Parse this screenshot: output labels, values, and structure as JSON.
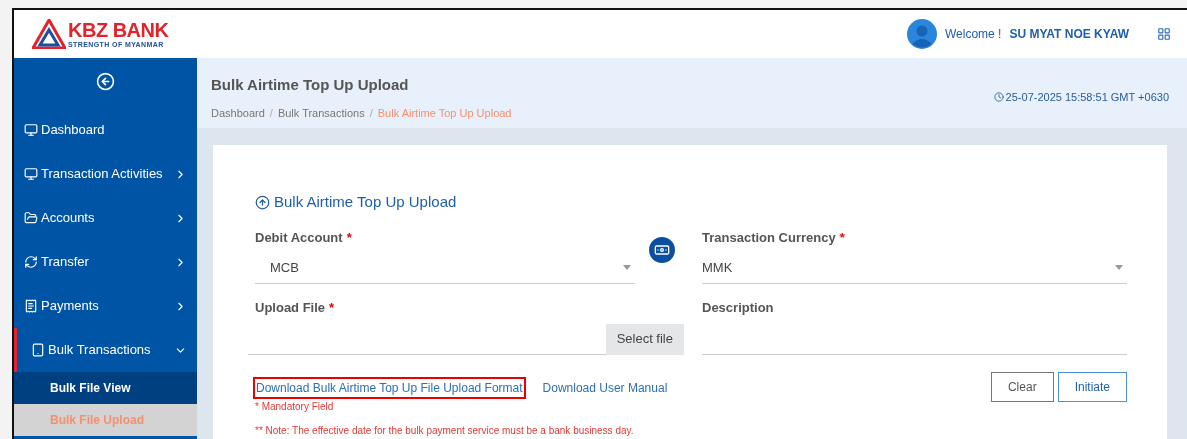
{
  "header": {
    "logo_name": "KBZ BANK",
    "logo_tagline": "STRENGTH OF MYANMAR",
    "welcome": "Welcome !",
    "user": "SU MYAT NOE KYAW"
  },
  "sidebar": {
    "items": [
      {
        "label": "Dashboard",
        "kind": "link",
        "expanded": false
      },
      {
        "label": "Transaction Activities",
        "kind": "menu",
        "expanded": false
      },
      {
        "label": "Accounts",
        "kind": "menu",
        "expanded": false
      },
      {
        "label": "Transfer",
        "kind": "menu",
        "expanded": false
      },
      {
        "label": "Payments",
        "kind": "menu",
        "expanded": false
      },
      {
        "label": "Bulk Transactions",
        "kind": "menu",
        "expanded": true,
        "children": [
          {
            "label": "Bulk File View",
            "selected": false
          },
          {
            "label": "Bulk File Upload",
            "selected": true
          }
        ]
      }
    ]
  },
  "page_header": {
    "title": "Bulk Airtime Top Up Upload",
    "breadcrumb": [
      {
        "label": "Dashboard",
        "current": false
      },
      {
        "label": "/",
        "kind": "separator"
      },
      {
        "label": "Bulk Transactions",
        "current": false
      },
      {
        "label": "/",
        "kind": "separator"
      },
      {
        "label": "Bulk Airtime Top Up Upload",
        "current": true
      }
    ],
    "datetime": "25-07-2025 15:58:51 GMT +0630"
  },
  "form": {
    "title": "Bulk Airtime Top Up Upload",
    "debit_account": {
      "label": "Debit Account",
      "required_mark": "*",
      "value": "MCB"
    },
    "transaction_currency": {
      "label": "Transaction Currency",
      "required_mark": "*",
      "value": "MMK"
    },
    "upload_file": {
      "label": "Upload File",
      "required_mark": "*",
      "button": "Select file"
    },
    "description": {
      "label": "Description"
    },
    "links": [
      {
        "label": "Download Bulk Airtime Top Up File Upload Format",
        "highlighted": true
      },
      {
        "label": "Download User Manual",
        "highlighted": false
      }
    ],
    "mandatory_note": "* Mandatory Field",
    "note": "** Note: The effective date for the bulk payment service must be a bank business day.",
    "buttons": [
      {
        "label": "Clear",
        "kind": "secondary"
      },
      {
        "label": "Initiate",
        "kind": "primary"
      }
    ]
  }
}
